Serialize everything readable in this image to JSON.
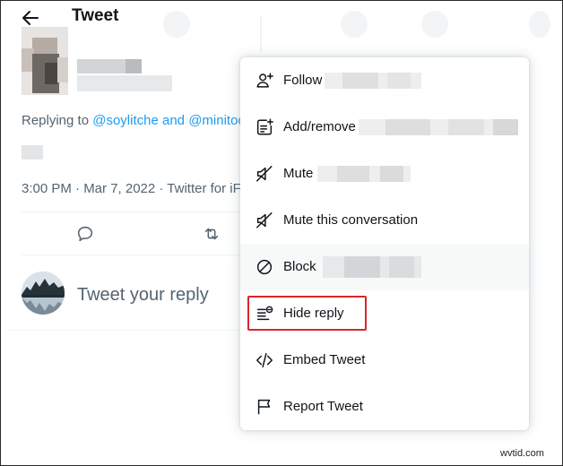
{
  "header": {
    "back_icon": "arrow-left-icon",
    "title": "Tweet"
  },
  "tweet": {
    "replying_prefix": "Replying to ",
    "mention_1": "@soylitche",
    "connector": " and ",
    "mention_2": "@minitoo",
    "timestamp": "3:00 PM · Mar 7, 2022 · Twitter for iF"
  },
  "actions": {
    "icons": [
      "reply-icon",
      "retweet-icon"
    ]
  },
  "reply_box": {
    "placeholder": "Tweet your reply"
  },
  "menu": {
    "items": [
      {
        "label": "Follow",
        "icon": "person-plus-icon"
      },
      {
        "label": "Add/remove",
        "icon": "list-add-icon"
      },
      {
        "label": "Mute",
        "icon": "speaker-muted-icon"
      },
      {
        "label": "Mute this conversation",
        "icon": "speaker-muted-icon"
      },
      {
        "label": "Block",
        "icon": "block-icon"
      },
      {
        "label": "Hide reply",
        "icon": "hide-reply-icon"
      },
      {
        "label": "Embed Tweet",
        "icon": "code-icon"
      },
      {
        "label": "Report Tweet",
        "icon": "flag-icon"
      }
    ],
    "hovered_item": "Block",
    "highlighted_item": "Hide reply"
  },
  "colors": {
    "accent": "#1d9bf0",
    "highlight_border": "#d8262c",
    "secondary_text": "#536471"
  },
  "watermark": "wvtid.com"
}
